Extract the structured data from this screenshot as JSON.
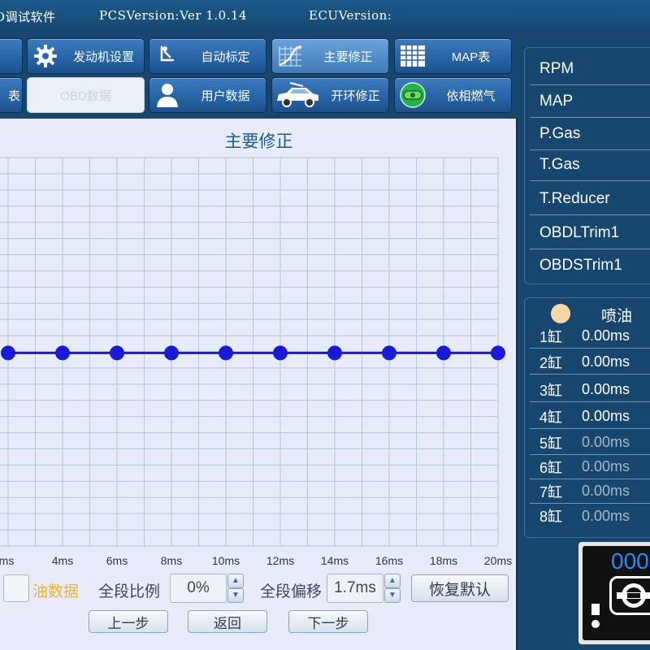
{
  "titlebar": {
    "app_fragment": "D调试软件",
    "pcs_version": "PCSVersion:Ver 1.0.14",
    "ecu_version": "ECUVersion:"
  },
  "toolbar": {
    "buttons": [
      {
        "label": "发动机设置",
        "icon": "gear-icon"
      },
      {
        "label": "自动标定",
        "icon": "seat-adjust-icon"
      },
      {
        "label": "主要修正",
        "icon": "curve-grid-icon"
      },
      {
        "label": "MAP表",
        "icon": "table-grid-icon"
      },
      {
        "label": "表",
        "icon": ""
      },
      {
        "label": "OBD数据",
        "icon": ""
      },
      {
        "label": "用户数据",
        "icon": "user-icon"
      },
      {
        "label": "开环修正",
        "icon": "car-icon"
      },
      {
        "label": "依相燃气",
        "icon": "gas-cylinder-icon"
      }
    ]
  },
  "chart": {
    "title": "主要修正",
    "x_tick_labels": [
      "ms",
      "4ms",
      "6ms",
      "8ms",
      "10ms",
      "12ms",
      "14ms",
      "16ms",
      "18ms",
      "20ms"
    ]
  },
  "chart_data": {
    "type": "line",
    "title": "主要修正",
    "x_unit": "ms",
    "x": [
      2,
      3,
      4,
      5,
      6,
      7,
      8,
      9,
      10,
      11,
      12,
      13,
      14,
      15,
      16,
      17,
      18,
      19,
      20
    ],
    "series": [
      {
        "values": [
          0,
          0,
          0,
          0,
          0,
          0,
          0,
          0,
          0,
          0,
          0,
          0,
          0,
          0,
          0,
          0,
          0,
          0,
          0
        ],
        "color": "#1a1ad6"
      }
    ],
    "grid": true,
    "x_range": [
      2,
      20
    ]
  },
  "controls": {
    "oil_data_label": "油数据",
    "overall_ratio_label": "全段比例",
    "overall_ratio_value": "0%",
    "overall_offset_label": "全段偏移",
    "overall_offset_value": "1.7ms",
    "restore_default": "恢复默认",
    "prev_step": "上一步",
    "back": "返回",
    "next_step": "下一步",
    "spin_up": "▲",
    "spin_down": "▼"
  },
  "sensors": [
    {
      "label": "RPM"
    },
    {
      "label": "MAP"
    },
    {
      "label": "P.Gas"
    },
    {
      "label": "T.Gas"
    },
    {
      "label": "T.Reducer"
    },
    {
      "label": "OBDLTrim1"
    },
    {
      "label": "OBDSTrim1"
    }
  ],
  "injection": {
    "header": "喷油",
    "rows": [
      {
        "cyl": "1缸",
        "value": "0.00ms",
        "active": true
      },
      {
        "cyl": "2缸",
        "value": "0.00ms",
        "active": true
      },
      {
        "cyl": "3缸",
        "value": "0.00ms",
        "active": true
      },
      {
        "cyl": "4缸",
        "value": "0.00ms",
        "active": true
      },
      {
        "cyl": "5缸",
        "value": "0.00ms",
        "active": false
      },
      {
        "cyl": "6缸",
        "value": "0.00ms",
        "active": false
      },
      {
        "cyl": "7缸",
        "value": "0.00ms",
        "active": false
      },
      {
        "cyl": "8缸",
        "value": "0.00ms",
        "active": false
      }
    ]
  },
  "device": {
    "counter": "000"
  },
  "colors": {
    "accent": "#17466e",
    "line": "#1a1ad6",
    "grid": "#b6c4d8",
    "counter": "#1f8fff",
    "oil_label": "#e8b240"
  }
}
